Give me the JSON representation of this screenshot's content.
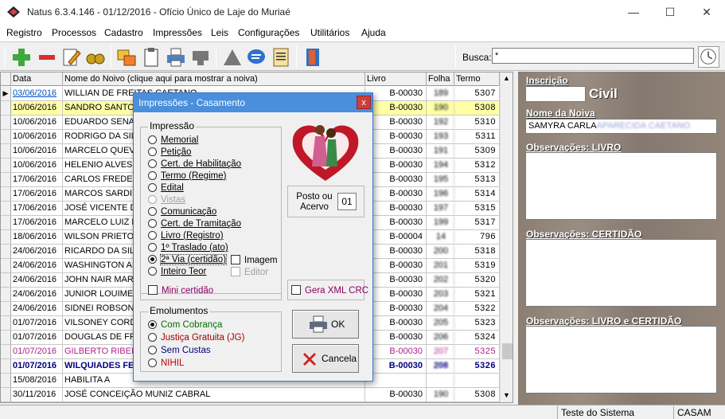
{
  "window": {
    "title": "Natus 6.3.4.146 - 01/12/2016 - Ofício Único de Laje do Muriaé",
    "minimize": "—",
    "maximize": "☐",
    "close": "✕"
  },
  "menu": [
    "Registro",
    "Processos",
    "Cadastro",
    "Impressões",
    "Leis",
    "Configurações",
    "Utilitários",
    "Ajuda"
  ],
  "toolbar": {
    "icons": [
      "add-icon",
      "remove-icon",
      "edit-icon",
      "binoculars-icon",
      "transfer-icon",
      "clipboard-icon",
      "printer-icon",
      "stamp-icon",
      "triangle-icon",
      "chat-icon",
      "notes-icon",
      "exit-icon"
    ],
    "search_label": "Busca:",
    "search_value": "*"
  },
  "grid": {
    "columns": [
      "Data",
      "Nome do Noivo      (clique aqui para mostrar a noiva)",
      "Livro",
      "Folha",
      "Termo"
    ],
    "rows": [
      {
        "date": "03/06/2016",
        "name": "WILLIAN DE FREITAS CAETANO",
        "livro": "B-00030",
        "folha": "189",
        "termo": "5307",
        "style": "current"
      },
      {
        "date": "10/06/2016",
        "name": "SANDRO SANTOS",
        "livro": "B-00030",
        "folha": "190",
        "termo": "5308",
        "style": "yellow"
      },
      {
        "date": "10/06/2016",
        "name": "EDUARDO SENA",
        "livro": "B-00030",
        "folha": "192",
        "termo": "5310",
        "style": ""
      },
      {
        "date": "10/06/2016",
        "name": "RODRIGO DA SILVA",
        "livro": "B-00030",
        "folha": "193",
        "termo": "5311",
        "style": ""
      },
      {
        "date": "10/06/2016",
        "name": "MARCELO QUEVEDO",
        "livro": "B-00030",
        "folha": "191",
        "termo": "5309",
        "style": ""
      },
      {
        "date": "10/06/2016",
        "name": "HELENIO ALVES",
        "livro": "B-00030",
        "folha": "194",
        "termo": "5312",
        "style": ""
      },
      {
        "date": "17/06/2016",
        "name": "CARLOS FREDERICO",
        "livro": "B-00030",
        "folha": "195",
        "termo": "5313",
        "style": ""
      },
      {
        "date": "17/06/2016",
        "name": "MARCOS SARDINHA",
        "livro": "B-00030",
        "folha": "196",
        "termo": "5314",
        "style": ""
      },
      {
        "date": "17/06/2016",
        "name": "JOSÉ VICENTE DA",
        "livro": "B-00030",
        "folha": "197",
        "termo": "5315",
        "style": ""
      },
      {
        "date": "17/06/2016",
        "name": "MARCELO LUIZ DA",
        "livro": "B-00030",
        "folha": "199",
        "termo": "5317",
        "style": ""
      },
      {
        "date": "18/06/2016",
        "name": "WILSON PRIETO",
        "livro": "B-00004",
        "folha": "14",
        "termo": "796",
        "style": ""
      },
      {
        "date": "24/06/2016",
        "name": "RICARDO DA SILVA",
        "livro": "B-00030",
        "folha": "200",
        "termo": "5318",
        "style": ""
      },
      {
        "date": "24/06/2016",
        "name": "WASHINGTON ALVES",
        "livro": "B-00030",
        "folha": "201",
        "termo": "5319",
        "style": ""
      },
      {
        "date": "24/06/2016",
        "name": "JOHN NAIR MARIANO",
        "livro": "B-00030",
        "folha": "202",
        "termo": "5320",
        "style": ""
      },
      {
        "date": "24/06/2016",
        "name": "JUNIOR LOUIME",
        "livro": "B-00030",
        "folha": "203",
        "termo": "5321",
        "style": ""
      },
      {
        "date": "24/06/2016",
        "name": "SIDNEI ROBSON",
        "livro": "B-00030",
        "folha": "204",
        "termo": "5322",
        "style": ""
      },
      {
        "date": "01/07/2016",
        "name": "VILSONEY CORDEIRO",
        "livro": "B-00030",
        "folha": "205",
        "termo": "5323",
        "style": ""
      },
      {
        "date": "01/07/2016",
        "name": "DOUGLAS DE FREITAS",
        "livro": "B-00030",
        "folha": "206",
        "termo": "5324",
        "style": ""
      },
      {
        "date": "01/07/2016",
        "name": "GILBERTO RIBEIRO",
        "livro": "B-00030",
        "folha": "207",
        "termo": "5325",
        "style": "magenta"
      },
      {
        "date": "01/07/2016",
        "name": "WILQUIADES FERREIRA",
        "livro": "B-00030",
        "folha": "208",
        "termo": "5326",
        "style": "bold"
      },
      {
        "date": "15/08/2016",
        "name": "HABILITA A",
        "livro": "",
        "folha": "",
        "termo": "",
        "style": ""
      },
      {
        "date": "30/11/2016",
        "name": "JOSÉ CONCEIÇÃO MUNIZ CABRAL",
        "livro": "B-00030",
        "folha": "190",
        "termo": "5308",
        "style": ""
      }
    ]
  },
  "right_panel": {
    "inscricao_label": "Inscrição",
    "inscricao_value": "",
    "civil_label": "Civil",
    "noiva_label": "Nome da Noiva",
    "noiva_value": "SAMYRA CARLA",
    "noiva_blurred": "APARECIDA CAETANO",
    "obs_livro": "Observações: LIVRO",
    "obs_certidao": "Observações: CERTIDÃO",
    "obs_livro_certidao": "Observações: LIVRO e CERTIDÃO"
  },
  "status": {
    "left": "",
    "middle": "Teste do Sistema",
    "right": "CASAM"
  },
  "dialog": {
    "title": "Impressões - Casamento",
    "close": "x",
    "impressao_group": "Impressão",
    "options": [
      {
        "label": "Memorial",
        "checked": false,
        "enabled": true
      },
      {
        "label": "Petição",
        "checked": false,
        "enabled": true
      },
      {
        "label": "Cert. de Habilitação",
        "checked": false,
        "enabled": true
      },
      {
        "label": "Termo (Regime)",
        "checked": false,
        "enabled": true
      },
      {
        "label": "Edital",
        "checked": false,
        "enabled": true
      },
      {
        "label": "Vistas",
        "checked": false,
        "enabled": false
      },
      {
        "label": "Comunicação",
        "checked": false,
        "enabled": true
      },
      {
        "label": "Cert. de Tramitação",
        "checked": false,
        "enabled": true
      },
      {
        "label": "Livro (Registro)",
        "checked": false,
        "enabled": true
      },
      {
        "label": "1º Traslado (ato)",
        "checked": false,
        "enabled": true
      },
      {
        "label": "2ª Via (certidão)",
        "checked": true,
        "enabled": true
      },
      {
        "label": "Inteiro Teor",
        "checked": false,
        "enabled": true
      }
    ],
    "imagem_label": "Imagem",
    "editor_label": "Editor",
    "mini_certidao": "Mini certidão",
    "posto_label": "Posto ou Acervo",
    "posto_value": "01",
    "xml_label": "Gera XML CRC",
    "emolumentos_group": "Emolumentos",
    "emolumentos": [
      {
        "label": "Com Cobrança",
        "checked": true,
        "color": "#007000"
      },
      {
        "label": "Justiça Gratuita (JG)",
        "checked": false,
        "color": "#a00000"
      },
      {
        "label": "Sem Custas",
        "checked": false,
        "color": "#00007a"
      },
      {
        "label": "NIHIL",
        "checked": false,
        "color": "#c00000"
      }
    ],
    "ok_label": "OK",
    "cancel_label": "Cancela"
  }
}
